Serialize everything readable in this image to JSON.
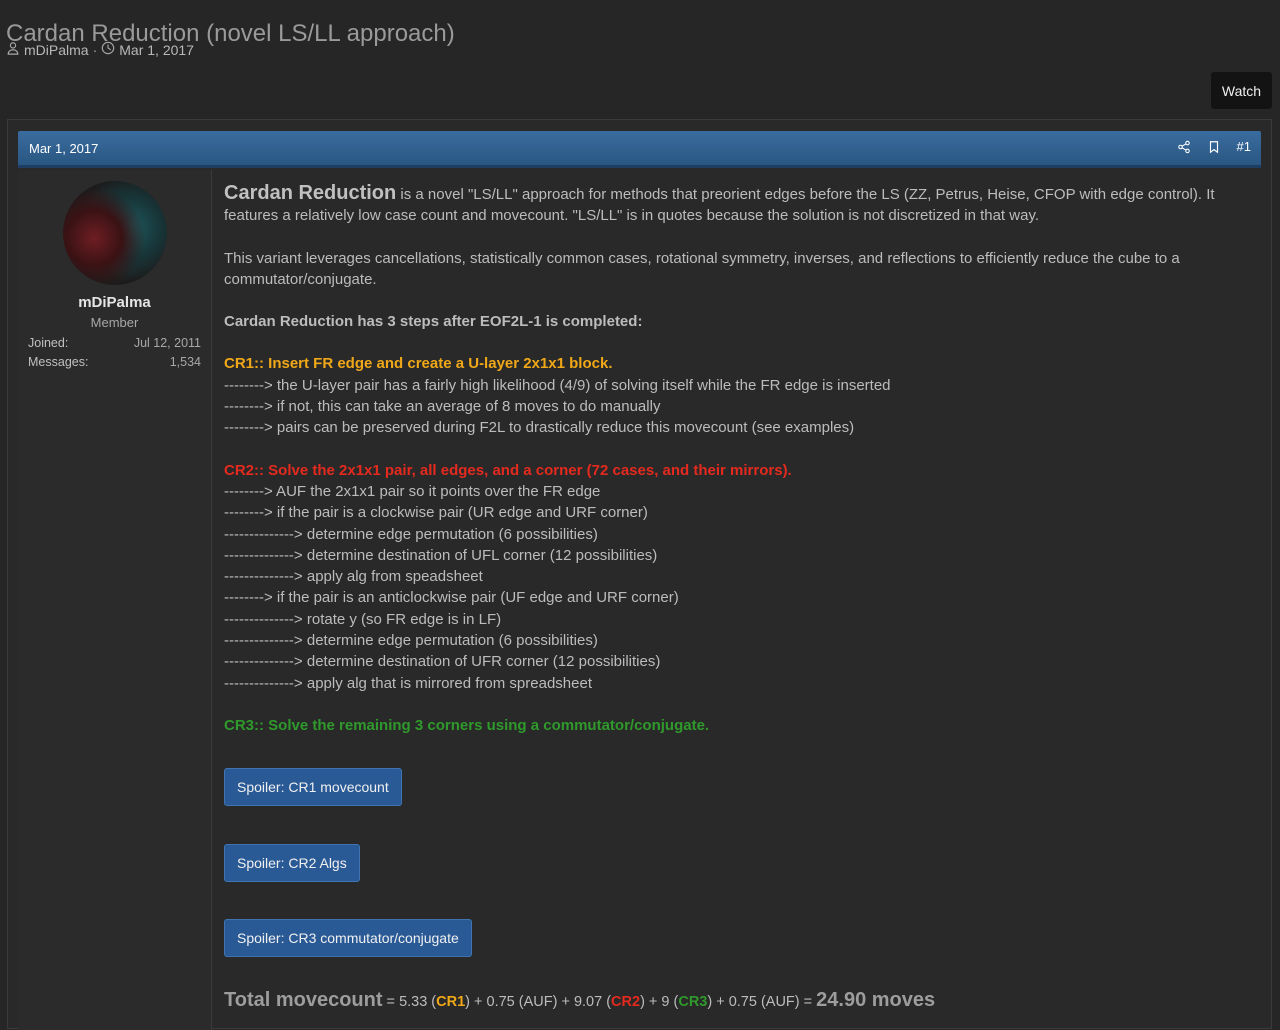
{
  "thread": {
    "title": "Cardan Reduction (novel LS/LL approach)",
    "author": "mDiPalma",
    "separator": "·",
    "date": "Mar 1, 2017",
    "watch_label": "Watch"
  },
  "post": {
    "date": "Mar 1, 2017",
    "number": "#1",
    "author": {
      "name": "mDiPalma",
      "title": "Member",
      "joined_label": "Joined:",
      "joined_value": "Jul 12, 2011",
      "messages_label": "Messages:",
      "messages_value": "1,534"
    },
    "intro_title": "Cardan Reduction",
    "intro_text": " is a novel \"LS/LL\" approach for methods that preorient edges before the LS (ZZ, Petrus, Heise, CFOP with edge control). It features a relatively low case count and movecount. \"LS/LL\" is in quotes because the solution is not discretized in that way.",
    "para2": "This variant leverages cancellations, statistically common cases, rotational symmetry, inverses, and reflections to efficiently reduce the cube to a commutator/conjugate.",
    "steps_heading": "Cardan Reduction has 3 steps after EOF2L-1 is completed:",
    "cr1": {
      "heading": "CR1:: Insert FR edge and create a U-layer 2x1x1 block.",
      "lines": [
        "--------> the U-layer pair has a fairly high likelihood (4/9) of solving itself while the FR edge is inserted",
        "--------> if not, this can take an average of 8 moves to do manually",
        "--------> pairs can be preserved during F2L to drastically reduce this movecount (see examples)"
      ]
    },
    "cr2": {
      "heading": "CR2:: Solve the 2x1x1 pair, all edges, and a corner (72 cases, and their mirrors).",
      "lines": [
        "--------> AUF the 2x1x1 pair so it points over the FR edge",
        "--------> if the pair is a clockwise pair (UR edge and URF corner)",
        "--------------> determine edge permutation (6 possibilities)",
        "--------------> determine destination of UFL corner (12 possibilities)",
        "--------------> apply alg from speadsheet",
        "--------> if the pair is an anticlockwise pair (UF edge and URF corner)",
        "--------------> rotate y (so FR edge is in LF)",
        "--------------> determine edge permutation (6 possibilities)",
        "--------------> determine destination of UFR corner (12 possibilities)",
        "--------------> apply alg that is mirrored from spreadsheet"
      ]
    },
    "cr3": {
      "heading": "CR3:: Solve the remaining 3 corners using a commutator/conjugate."
    },
    "spoilers": [
      "Spoiler: CR1 movecount",
      "Spoiler: CR2 Algs",
      "Spoiler: CR3 commutator/conjugate"
    ],
    "total": {
      "label": "Total movecount",
      "eq": " = ",
      "p1": "5.33 (",
      "cr1": "CR1",
      "p2": ") + 0.75 (AUF) + 9.07 (",
      "cr2": "CR2",
      "p3": ") + 9 (",
      "cr3": "CR3",
      "p4": ") + 0.75 (AUF) = ",
      "result": "24.90 moves"
    }
  },
  "colors": {
    "cr1": "#f0a818",
    "cr2": "#e42a1e",
    "cr3": "#2f9a2b",
    "header_bar": "#2f6192",
    "spoiler_button": "#2a5a96"
  }
}
